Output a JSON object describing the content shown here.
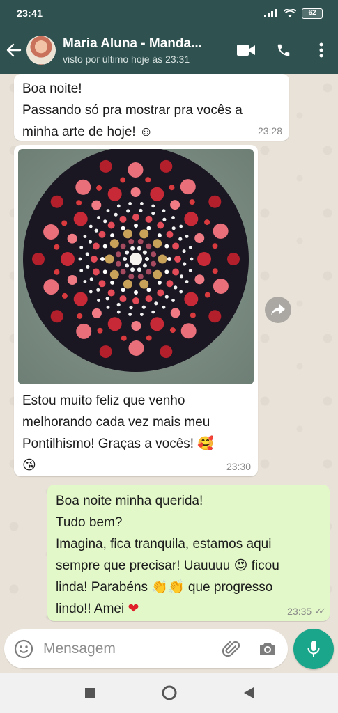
{
  "status_bar": {
    "time": "23:41",
    "battery": "62"
  },
  "header": {
    "contact_name": "Maria Aluna - Manda...",
    "contact_status": "visto por último hoje às 23:31"
  },
  "messages": [
    {
      "direction": "in",
      "text": "Boa noite!\nPassando só pra mostrar pra vocês a\nminha arte de hoje! ☺",
      "time": "23:28"
    },
    {
      "direction": "in",
      "has_image": true,
      "text": "Estou muito feliz que venho\nmelhorando cada vez mais meu\nPontilhismo! Graças a vocês! 🥰\n😘",
      "time": "23:30"
    },
    {
      "direction": "out",
      "text": "Boa noite minha querida!\nTudo bem?\nImagina, fica tranquila, estamos aqui\nsempre que precisar!  Uauuuu 😍 ficou\nlinda! Parabéns 👏👏 que progresso\nlindo!! Amei",
      "heart": "❤",
      "time": "23:35",
      "read_receipt": "✓✓"
    }
  ],
  "input": {
    "placeholder": "Mensagem"
  },
  "colors": {
    "header": "#2f5251",
    "outgoing_bubble": "#e2f8c9",
    "mic_button": "#1aa68a",
    "chat_bg": "#e9e2d8"
  }
}
